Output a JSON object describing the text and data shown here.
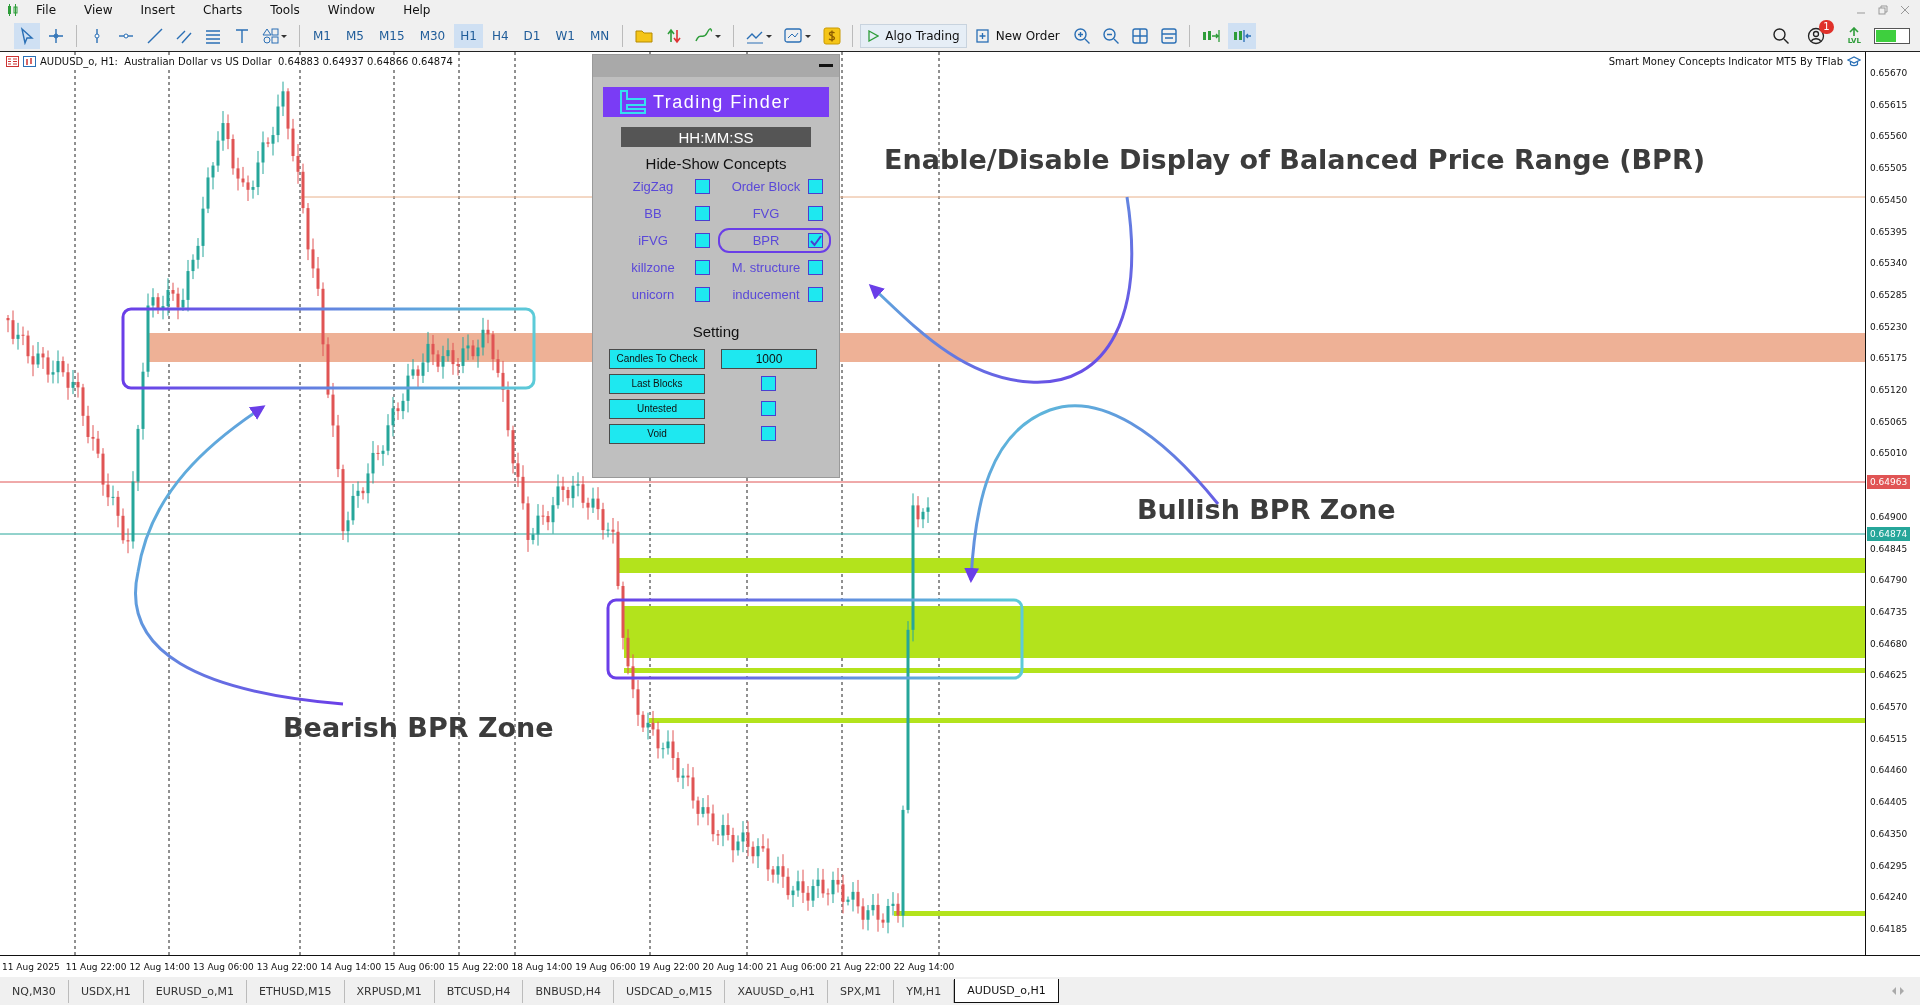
{
  "menu": [
    "File",
    "View",
    "Insert",
    "Charts",
    "Tools",
    "Window",
    "Help"
  ],
  "toolbar": {
    "timeframes": [
      {
        "label": "M1",
        "selected": false
      },
      {
        "label": "M5",
        "selected": false
      },
      {
        "label": "M15",
        "selected": false
      },
      {
        "label": "M30",
        "selected": false
      },
      {
        "label": "H1",
        "selected": true
      },
      {
        "label": "H4",
        "selected": false
      },
      {
        "label": "D1",
        "selected": false
      },
      {
        "label": "W1",
        "selected": false
      },
      {
        "label": "MN",
        "selected": false
      }
    ],
    "algo_trading": "Algo Trading",
    "new_order": "New Order",
    "notification_count": "1",
    "level_label": "LVL"
  },
  "chart": {
    "header": "AUDUSD_o, H1:  Australian Dollar vs US Dollar  0.64883 0.64937 0.64866 0.64874",
    "indicator_label": "Smart Money Concepts Indicator MT5 By TFlab",
    "price_labels": [
      "0.65670",
      "0.65615",
      "0.65560",
      "0.65505",
      "0.65450",
      "0.65395",
      "0.65340",
      "0.65285",
      "0.65230",
      "0.65175",
      "0.65120",
      "0.65065",
      "0.65010",
      "0.64900",
      "0.64845",
      "0.64790",
      "0.64735",
      "0.64680",
      "0.64625",
      "0.64570",
      "0.64515",
      "0.64460",
      "0.64405",
      "0.64350",
      "0.64295",
      "0.64240",
      "0.64185"
    ],
    "price_tags": [
      {
        "text": "0.64963",
        "color": "#e05454"
      },
      {
        "text": "0.64874",
        "color": "#26a69a"
      }
    ],
    "time_labels": [
      "11 Aug 2025",
      "11 Aug 22:00",
      "12 Aug 14:00",
      "13 Aug 06:00",
      "13 Aug 22:00",
      "14 Aug 14:00",
      "15 Aug 06:00",
      "15 Aug 22:00",
      "18 Aug 14:00",
      "19 Aug 06:00",
      "19 Aug 22:00",
      "20 Aug 14:00",
      "21 Aug 06:00",
      "21 Aug 22:00",
      "22 Aug 14:00"
    ]
  },
  "panel": {
    "logo": "Trading Finder",
    "clock": "HH:MM:SS",
    "concepts_title": "Hide-Show Concepts",
    "concepts": [
      {
        "label": "ZigZag",
        "checked": false,
        "highlighted": false
      },
      {
        "label": "Order Block",
        "checked": false,
        "highlighted": false
      },
      {
        "label": "BB",
        "checked": false,
        "highlighted": false
      },
      {
        "label": "FVG",
        "checked": false,
        "highlighted": false
      },
      {
        "label": "iFVG",
        "checked": false,
        "highlighted": false
      },
      {
        "label": "BPR",
        "checked": true,
        "highlighted": true
      },
      {
        "label": "killzone",
        "checked": false,
        "highlighted": false
      },
      {
        "label": "M. structure",
        "checked": false,
        "highlighted": false
      },
      {
        "label": "unicorn",
        "checked": false,
        "highlighted": false
      },
      {
        "label": "inducement",
        "checked": false,
        "highlighted": false
      }
    ],
    "setting_title": "Setting",
    "settings": [
      {
        "label": "Candles To Check",
        "kind": "input",
        "value": "1000"
      },
      {
        "label": "Last Blocks",
        "kind": "checkbox",
        "checked": false
      },
      {
        "label": "Untested",
        "kind": "checkbox",
        "checked": false
      },
      {
        "label": "Void",
        "kind": "checkbox",
        "checked": false
      }
    ]
  },
  "annotations": {
    "toggle_note": "Enable/Disable Display of Balanced Price Range (BPR)",
    "bullish_label": "Bullish BPR Zone",
    "bearish_label": "Bearish BPR Zone"
  },
  "tabs": [
    {
      "label": "NQ,M30",
      "selected": false
    },
    {
      "label": "USDX,H1",
      "selected": false
    },
    {
      "label": "EURUSD_o,M1",
      "selected": false
    },
    {
      "label": "ETHUSD,M15",
      "selected": false
    },
    {
      "label": "XRPUSD,M1",
      "selected": false
    },
    {
      "label": "BTCUSD,H4",
      "selected": false
    },
    {
      "label": "BNBUSD,H4",
      "selected": false
    },
    {
      "label": "USDCAD_o,M15",
      "selected": false
    },
    {
      "label": "XAUUSD_o,H1",
      "selected": false
    },
    {
      "label": "SPX,M1",
      "selected": false
    },
    {
      "label": "YM,H1",
      "selected": false
    },
    {
      "label": "AUDUSD_o,H1",
      "selected": true
    }
  ]
}
